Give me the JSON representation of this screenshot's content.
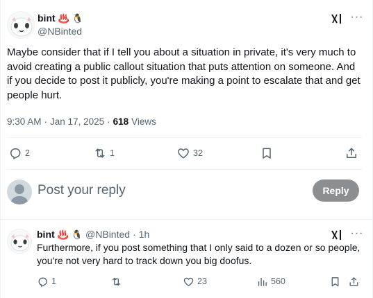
{
  "main_post": {
    "display_name": "bint",
    "emoji_1": "♨️",
    "emoji_2": "🐧",
    "handle": "@NBinted",
    "text": "Maybe consider that if I tell you about a situation in private, it's very much to avoid creating a public callout situation that puts attention on someone. And if you decide to post it publicly, you're making a point to escalate that and get people hurt.",
    "time": "9:30 AM",
    "date": "Jan 17, 2025",
    "views_count": "618",
    "views_label": "Views",
    "actions": {
      "replies": "2",
      "reposts": "1",
      "likes": "32"
    }
  },
  "composer": {
    "placeholder": "Post your reply",
    "button_label": "Reply"
  },
  "reply_post": {
    "display_name": "bint",
    "emoji_1": "♨️",
    "emoji_2": "🐧",
    "handle": "@NBinted",
    "separator": "·",
    "age": "1h",
    "text": "Furthermore, if you post something that I only said to a dozen or so people, you're not very hard to track down you big doofus.",
    "actions": {
      "replies": "1",
      "reposts": "",
      "likes": "23",
      "views": "560"
    }
  },
  "icons": {
    "reply": "speech-bubble-icon",
    "repost": "repost-arrows-icon",
    "like": "heart-icon",
    "bookmark": "bookmark-icon",
    "share": "share-upload-icon",
    "views": "bar-chart-icon",
    "grok": "grok-icon",
    "more": "more-dots-icon"
  },
  "colors": {
    "text_primary": "#0f1419",
    "text_secondary": "#536471",
    "reply_button_bg": "#8b8f92",
    "divider": "#eff3f4",
    "emoji_steam": "#e0393e"
  }
}
